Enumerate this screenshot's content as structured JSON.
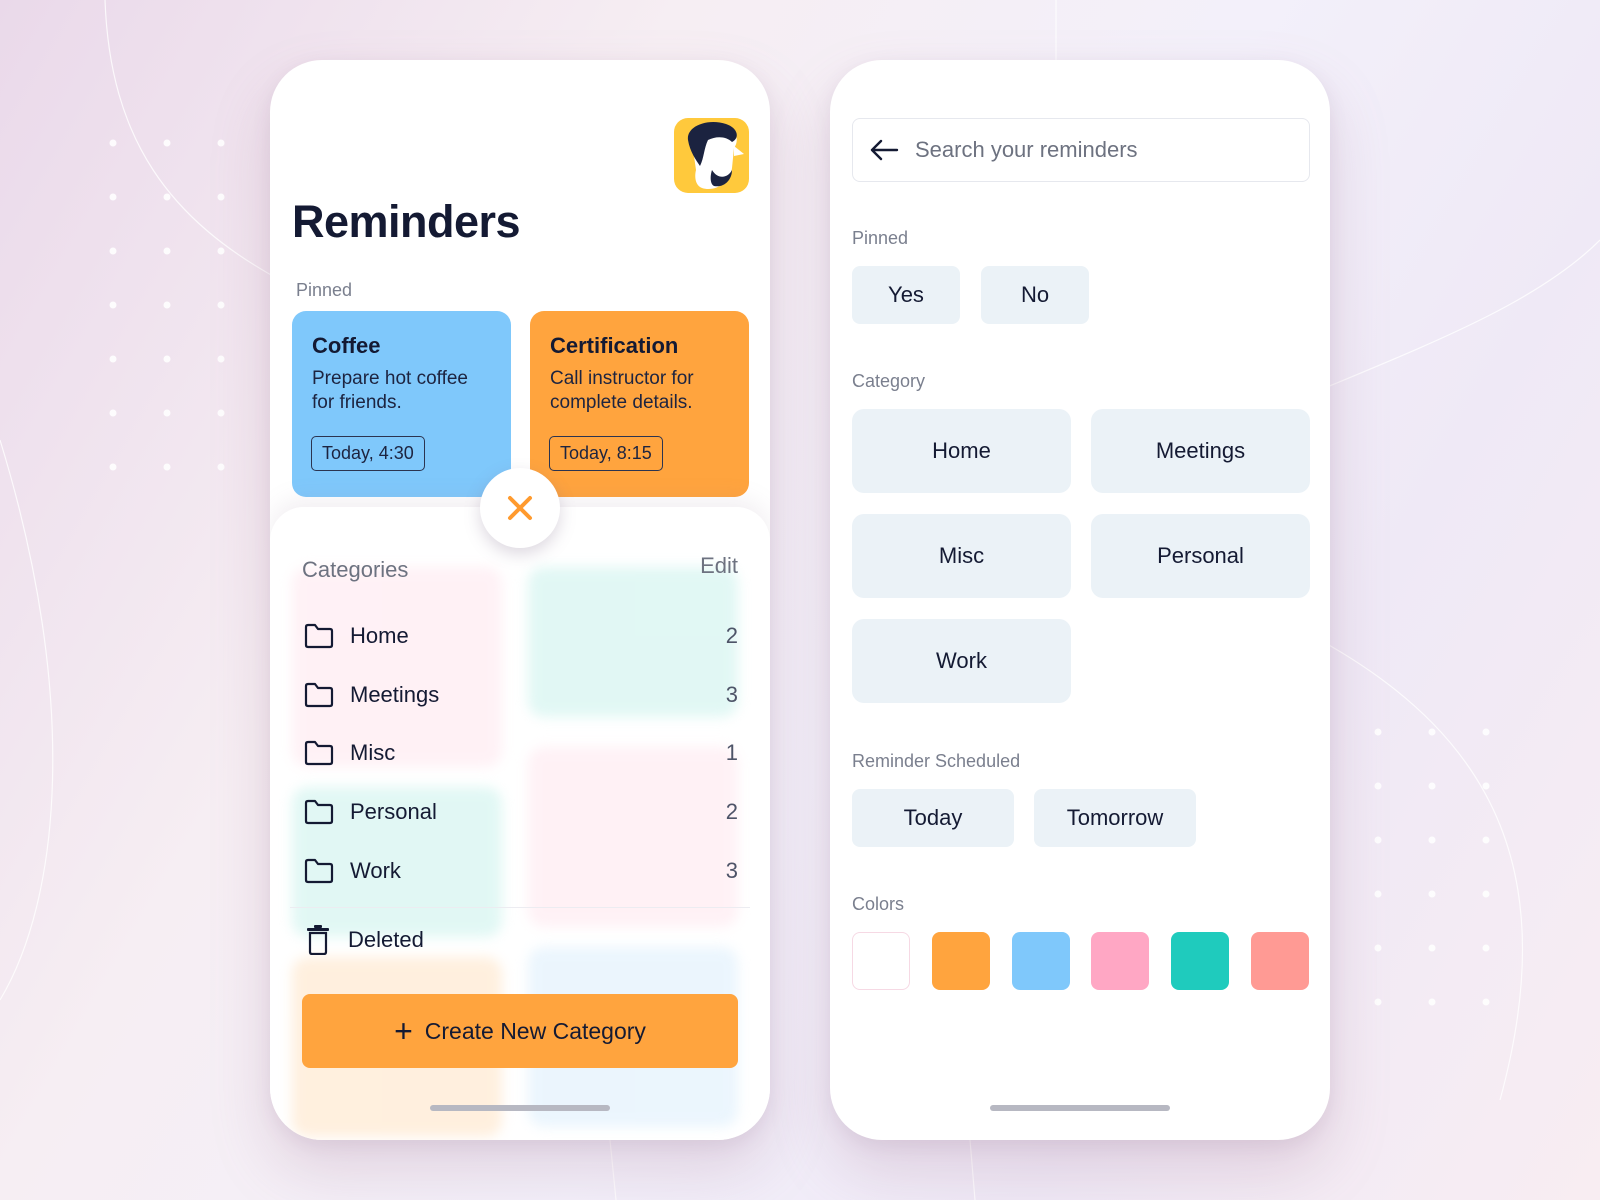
{
  "left": {
    "title": "Reminders",
    "pinned_label": "Pinned",
    "pinned_cards": [
      {
        "title": "Coffee",
        "description": "Prepare hot coffee for friends.",
        "time": "Today, 4:30",
        "color": "#7fc8fb"
      },
      {
        "title": "Certification",
        "description": "Call instructor for complete details.",
        "time": "Today, 8:15",
        "color": "#ffa43e"
      }
    ],
    "sheet": {
      "title": "Categories",
      "edit_label": "Edit",
      "categories": [
        {
          "name": "Home",
          "count": "2"
        },
        {
          "name": "Meetings",
          "count": "3"
        },
        {
          "name": "Misc",
          "count": "1"
        },
        {
          "name": "Personal",
          "count": "2"
        },
        {
          "name": "Work",
          "count": "3"
        }
      ],
      "deleted_label": "Deleted",
      "create_label": "Create New Category"
    }
  },
  "right": {
    "search_placeholder": "Search your reminders",
    "pinned_label": "Pinned",
    "pinned_options": [
      "Yes",
      "No"
    ],
    "category_label": "Category",
    "category_options": [
      "Home",
      "Meetings",
      "Misc",
      "Personal",
      "Work"
    ],
    "schedule_label": "Reminder Scheduled",
    "schedule_options": [
      "Today",
      "Tomorrow"
    ],
    "colors_label": "Colors",
    "colors": [
      "#ffffff",
      "#ffa43e",
      "#7fc8fb",
      "#ffa7c4",
      "#1fcbbd",
      "#ff9a94"
    ]
  },
  "accent_color": "#ffa43e"
}
